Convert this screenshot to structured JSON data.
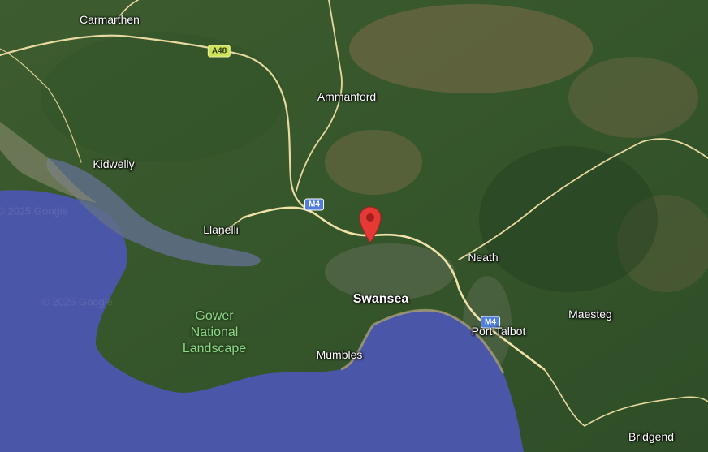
{
  "map": {
    "type": "satellite",
    "region": "South Wales",
    "colors": {
      "sea": "#4a57a8",
      "land": "#3a5a30",
      "marker": "#e53935",
      "road": "#e8d9a0"
    }
  },
  "places": {
    "carmarthen": "Carmarthen",
    "ammanford": "Ammanford",
    "kidwelly": "Kidwelly",
    "llanelli": "Llanelli",
    "neath": "Neath",
    "swansea": "Swansea",
    "port_talbot": "Port Talbot",
    "maesteg": "Maesteg",
    "mumbles": "Mumbles",
    "bridgend": "Bridgend",
    "gower_line1": "Gower",
    "gower_line2": "National",
    "gower_line3": "Landscape"
  },
  "roads": {
    "a48": "A48",
    "m4_north": "M4",
    "m4_south": "M4"
  },
  "watermarks": {
    "w1": "© 2025 Google",
    "w2": "© 2025 Google"
  },
  "marker": {
    "icon": "map-pin-icon"
  }
}
